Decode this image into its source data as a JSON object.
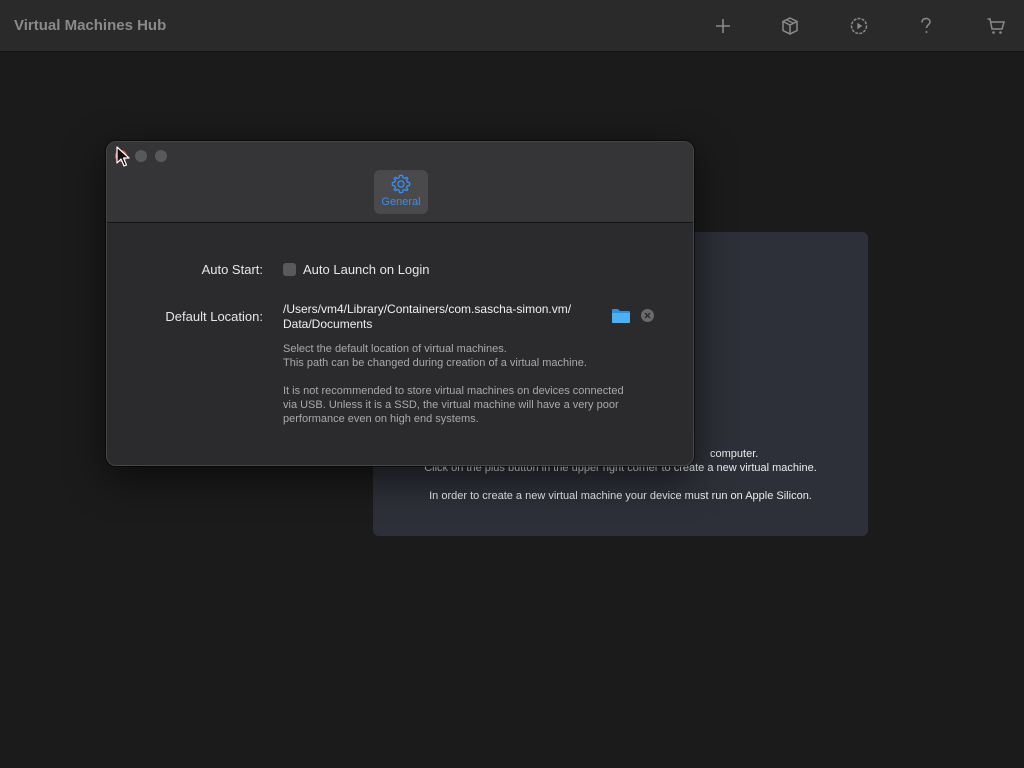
{
  "app": {
    "title": "Virtual Machines Hub"
  },
  "toolbar": {
    "buttons": [
      {
        "name": "add-vm-button",
        "icon": "plus-icon"
      },
      {
        "name": "install-button",
        "icon": "package-icon"
      },
      {
        "name": "run-button",
        "icon": "play-gauge-icon"
      },
      {
        "name": "help-button",
        "icon": "question-icon"
      },
      {
        "name": "store-button",
        "icon": "cart-icon"
      }
    ]
  },
  "empty_state": {
    "line1": "computer.",
    "line2": "Click on the plus button in the upper right corner to create a new virtual machine.",
    "line3": "In order to create a new virtual machine your device must run on Apple Silicon."
  },
  "preferences": {
    "tab": {
      "label": "General",
      "icon": "gear-icon"
    },
    "auto_start": {
      "label": "Auto Start:",
      "checkbox_label": "Auto Launch on Login",
      "checked": false
    },
    "default_location": {
      "label": "Default Location:",
      "path_line1": "/Users/vm4/Library/Containers/com.sascha-simon.vm/",
      "path_line2": "Data/Documents",
      "help1": "Select the default location of virtual machines.",
      "help2": "This path can be changed during creation of a virtual machine.",
      "help3": "It is not recommended to store virtual machines on devices connected",
      "help4": "via USB. Unless it is a SSD, the virtual machine will have a very poor",
      "help5": "performance even on high end systems."
    }
  },
  "colors": {
    "accent": "#3a8cf0",
    "close": "#e0554b",
    "folder": "#3ea2e8"
  }
}
